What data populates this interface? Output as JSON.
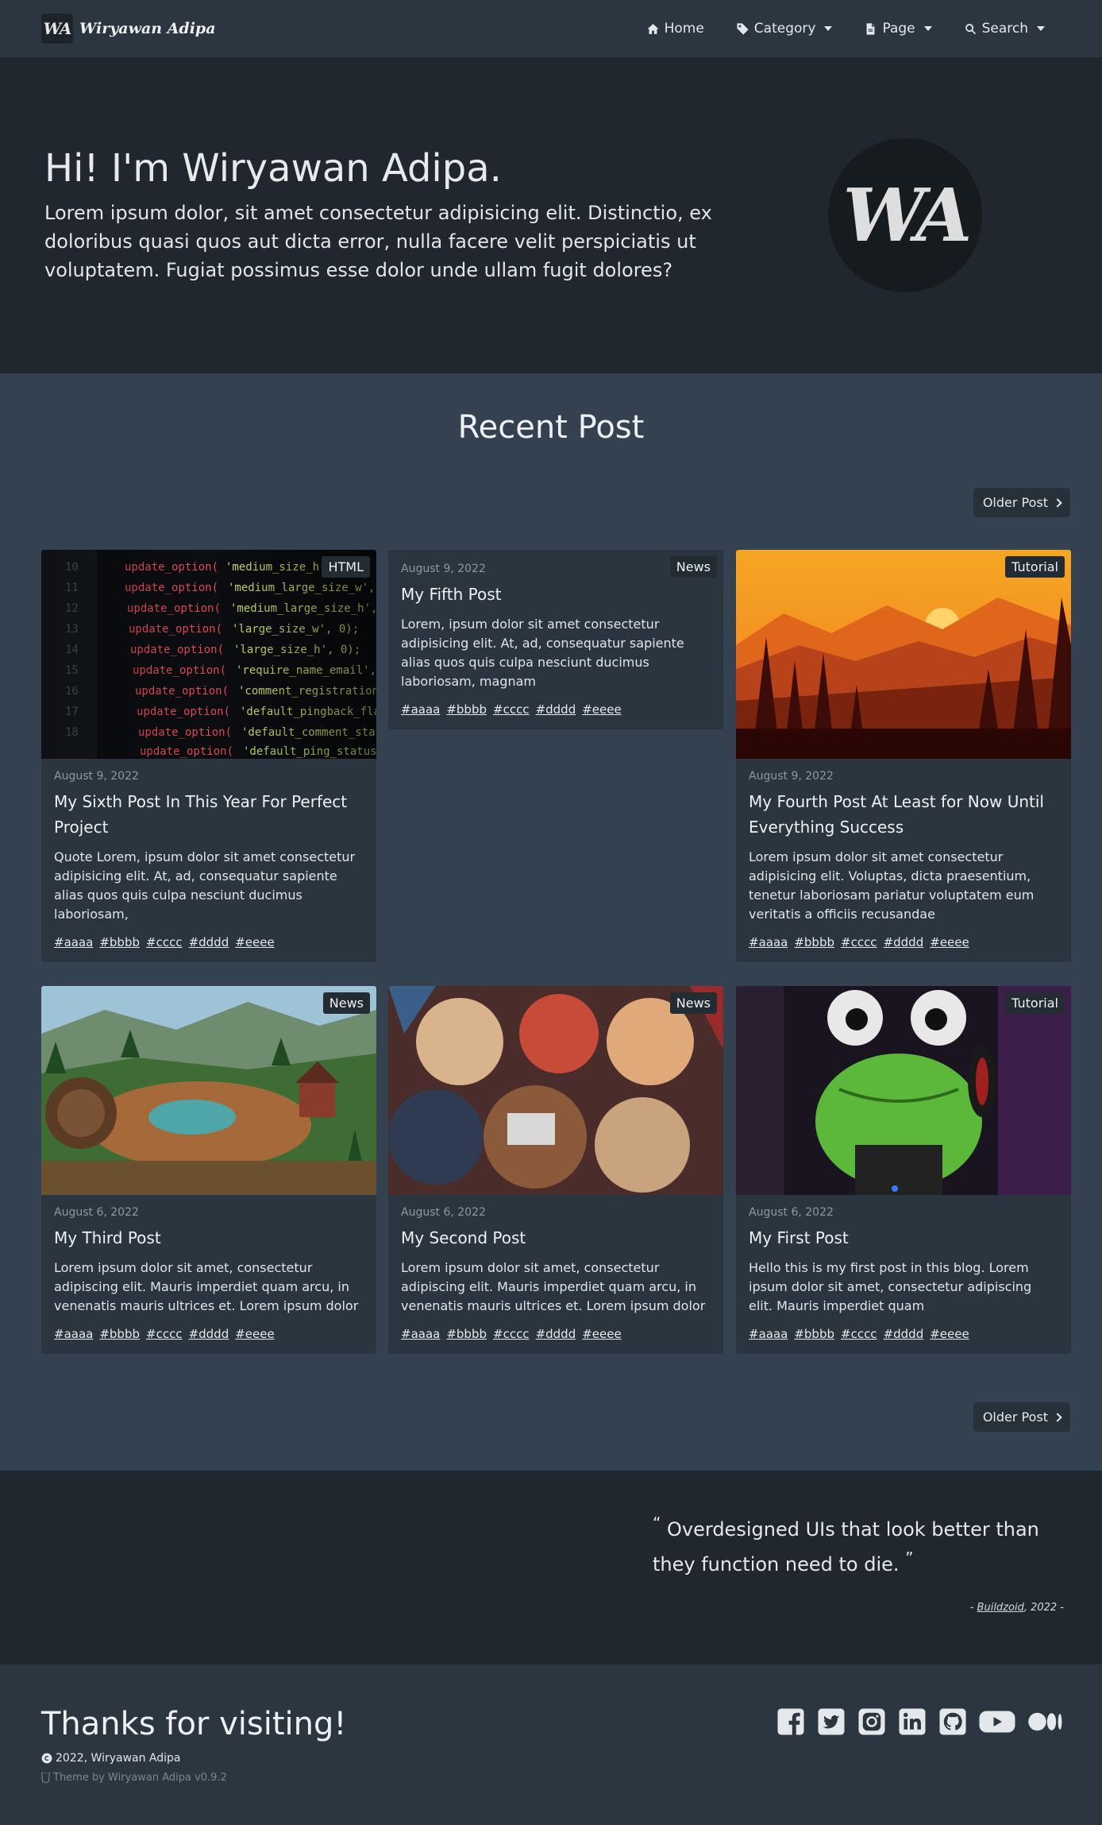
{
  "nav": {
    "brand_logo": "WA",
    "brand_name": "Wiryawan Adipa",
    "items": [
      {
        "label": "Home",
        "icon": "home-icon"
      },
      {
        "label": "Category",
        "icon": "tag-icon"
      },
      {
        "label": "Page",
        "icon": "file-icon"
      },
      {
        "label": "Search",
        "icon": "search-icon"
      }
    ]
  },
  "hero": {
    "title": "Hi! I'm Wiryawan Adipa.",
    "text": "Lorem ipsum dolor, sit amet consectetur adipisicing elit. Distinctio, ex doloribus quasi quos aut dicta error, nulla facere velit perspiciatis ut voluptatem. Fugiat possimus esse dolor unde ullam fugit dolores?",
    "avatar": "WA"
  },
  "recent": {
    "title": "Recent Post",
    "older_label": "Older Post"
  },
  "posts": [
    {
      "badge": "HTML",
      "date": "August 9, 2022",
      "title": "My Sixth Post In This Year For Perfect Project",
      "text": "Quote Lorem, ipsum dolor sit amet consectetur adipisicing elit. At, ad, consequatur sapiente alias quos quis culpa nesciunt ducimus laboriosam,",
      "tags": [
        "#aaaa",
        "#bbbb",
        "#cccc",
        "#dddd",
        "#eeee"
      ]
    },
    {
      "badge": "News",
      "date": "August 9, 2022",
      "title": "My Fifth Post",
      "text": "Lorem, ipsum dolor sit amet consectetur adipisicing elit. At, ad, consequatur sapiente alias quos quis culpa nesciunt ducimus laboriosam, magnam",
      "tags": [
        "#aaaa",
        "#bbbb",
        "#cccc",
        "#dddd",
        "#eeee"
      ]
    },
    {
      "badge": "Tutorial",
      "date": "August 9, 2022",
      "title": "My Fourth Post At Least for Now Until Everything Success",
      "text": "Lorem ipsum dolor sit amet consectetur adipisicing elit. Voluptas, dicta praesentium, tenetur laboriosam pariatur voluptatem eum veritatis a officiis recusandae",
      "tags": [
        "#aaaa",
        "#bbbb",
        "#cccc",
        "#dddd",
        "#eeee"
      ]
    },
    {
      "badge": "News",
      "date": "August 6, 2022",
      "title": "My Third Post",
      "text": "Lorem ipsum dolor sit amet, consectetur adipiscing elit. Mauris imperdiet quam arcu, in venenatis mauris ultrices et. Lorem ipsum dolor",
      "tags": [
        "#aaaa",
        "#bbbb",
        "#cccc",
        "#dddd",
        "#eeee"
      ]
    },
    {
      "badge": "News",
      "date": "August 6, 2022",
      "title": "My Second Post",
      "text": "Lorem ipsum dolor sit amet, consectetur adipiscing elit. Mauris imperdiet quam arcu, in venenatis mauris ultrices et. Lorem ipsum dolor",
      "tags": [
        "#aaaa",
        "#bbbb",
        "#cccc",
        "#dddd",
        "#eeee"
      ]
    },
    {
      "badge": "Tutorial",
      "date": "August 6, 2022",
      "title": "My First Post",
      "text": "Hello this is my first post in this blog. Lorem ipsum dolor sit amet, consectetur adipiscing elit. Mauris imperdiet quam",
      "tags": [
        "#aaaa",
        "#bbbb",
        "#cccc",
        "#dddd",
        "#eeee"
      ]
    }
  ],
  "quote": {
    "open": "“",
    "text": "Overdesigned UIs that look better than they function need to die.",
    "close": "”",
    "cite_prefix": "-",
    "author": "Buildzoid",
    "cite_suffix": ", 2022 -"
  },
  "footer": {
    "title": "Thanks for visiting!",
    "copyright": "2022, Wiryawan Adipa",
    "theme": "Theme by Wiryawan Adipa v0.9.2",
    "socials": [
      "facebook-icon",
      "twitter-icon",
      "instagram-icon",
      "linkedin-icon",
      "github-icon",
      "youtube-icon",
      "medium-icon"
    ]
  }
}
